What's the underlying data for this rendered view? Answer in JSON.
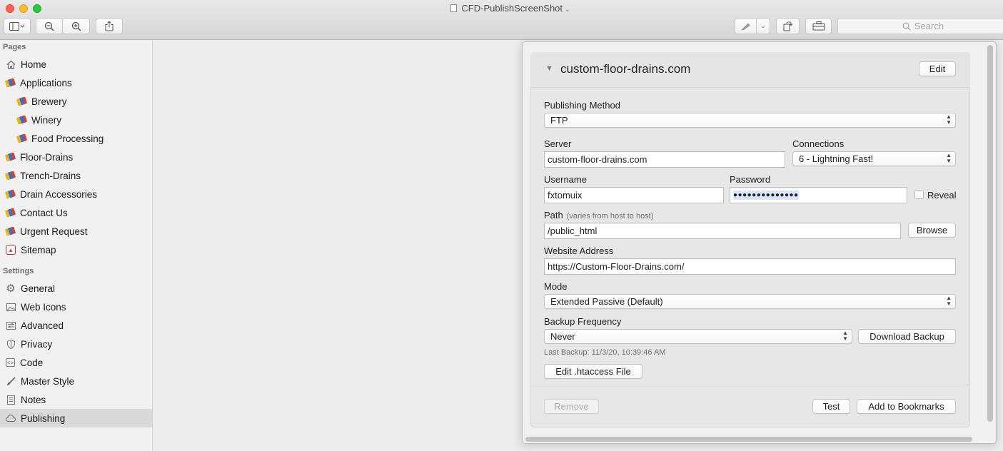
{
  "window": {
    "title": "CFD-PublishScreenShot",
    "search_placeholder": "Search"
  },
  "sidebar": {
    "pages_label": "Pages",
    "pages": [
      {
        "label": "Home",
        "icon": "home-icon"
      },
      {
        "label": "Applications",
        "icon": "page-icon"
      },
      {
        "label": "Brewery",
        "icon": "page-icon"
      },
      {
        "label": "Winery",
        "icon": "page-icon"
      },
      {
        "label": "Food Processing",
        "icon": "page-icon"
      },
      {
        "label": "Floor-Drains",
        "icon": "page-icon"
      },
      {
        "label": "Trench-Drains",
        "icon": "page-icon"
      },
      {
        "label": "Drain Accessories",
        "icon": "page-icon"
      },
      {
        "label": "Contact Us",
        "icon": "page-icon"
      },
      {
        "label": "Urgent Request",
        "icon": "page-icon"
      },
      {
        "label": "Sitemap",
        "icon": "sitemap-icon"
      }
    ],
    "settings_label": "Settings",
    "settings": [
      {
        "label": "General",
        "icon": "gear-icon"
      },
      {
        "label": "Web Icons",
        "icon": "image-icon"
      },
      {
        "label": "Advanced",
        "icon": "advanced-icon"
      },
      {
        "label": "Privacy",
        "icon": "shield-icon"
      },
      {
        "label": "Code",
        "icon": "code-icon"
      },
      {
        "label": "Master Style",
        "icon": "brush-icon"
      },
      {
        "label": "Notes",
        "icon": "notes-icon"
      },
      {
        "label": "Publishing",
        "icon": "cloud-icon",
        "selected": true
      }
    ]
  },
  "publish": {
    "site_name": "custom-floor-drains.com",
    "edit_label": "Edit",
    "method_label": "Publishing Method",
    "method_value": "FTP",
    "server_label": "Server",
    "server_value": "custom-floor-drains.com",
    "connections_label": "Connections",
    "connections_value": "6 - Lightning Fast!",
    "username_label": "Username",
    "username_value": "fxtomuix",
    "password_label": "Password",
    "password_value": "●●●●●●●●●●●●●●",
    "reveal_label": "Reveal",
    "path_label": "Path",
    "path_hint": "(varies from host to host)",
    "path_value": "/public_html",
    "browse_label": "Browse",
    "website_label": "Website Address",
    "website_value": "https://Custom-Floor-Drains.com/",
    "mode_label": "Mode",
    "mode_value": "Extended Passive (Default)",
    "backup_label": "Backup Frequency",
    "backup_value": "Never",
    "download_backup_label": "Download Backup",
    "last_backup": "Last Backup: 11/3/20, 10:39:46 AM",
    "htaccess_label": "Edit .htaccess File",
    "remove_label": "Remove",
    "test_label": "Test",
    "bookmarks_label": "Add to Bookmarks"
  }
}
